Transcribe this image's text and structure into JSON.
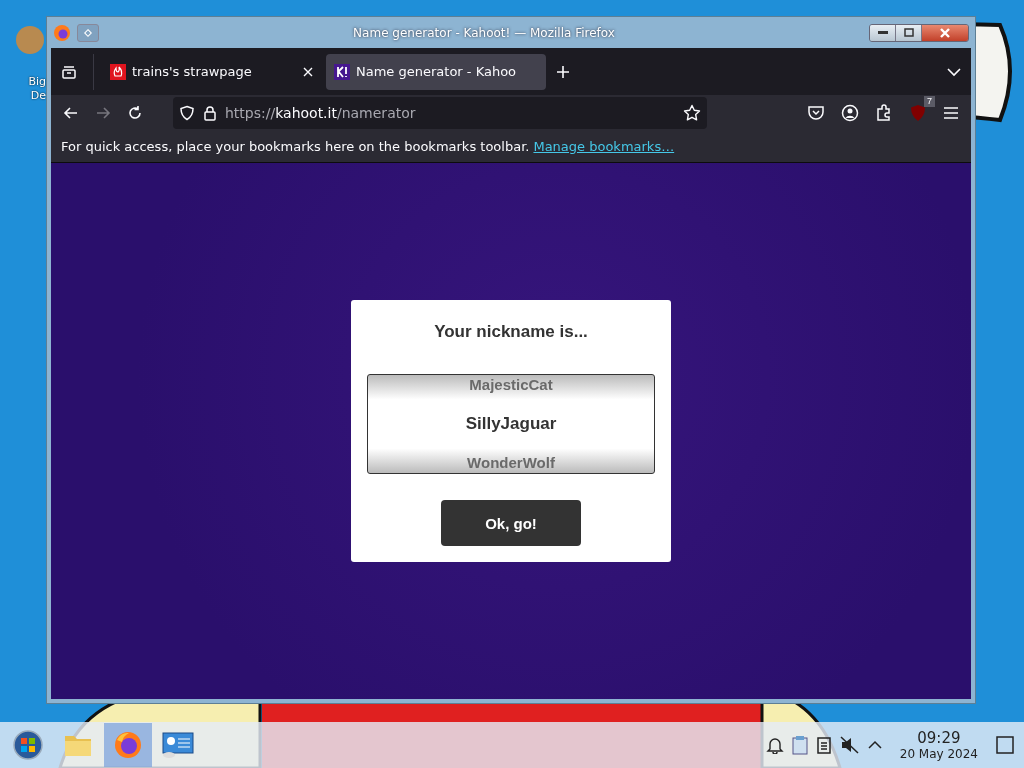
{
  "desktop": {
    "icon_label": [
      "Big",
      "De"
    ]
  },
  "window": {
    "title": "Name generator - Kahoot! — Mozilla Firefox"
  },
  "tabs": [
    {
      "title": "trains's strawpage",
      "selected": false
    },
    {
      "title": "Name generator - Kahoo",
      "selected": true
    }
  ],
  "address_bar": {
    "scheme": "https://",
    "host": "kahoot.it",
    "path": "/namerator"
  },
  "extension_badge": "7",
  "bookmarks_bar": {
    "message": "For quick access, place your bookmarks here on the bookmarks toolbar.",
    "link": "Manage bookmarks…"
  },
  "dialog": {
    "title": "Your nickname is...",
    "names": [
      {
        "name": "MajesticCat",
        "selected": false
      },
      {
        "name": "SillyJaguar",
        "selected": true
      },
      {
        "name": "WonderWolf",
        "selected": false
      }
    ],
    "button": "Ok, go!"
  },
  "taskbar": {
    "apps": [
      {
        "kind": "files",
        "active": false
      },
      {
        "kind": "browser",
        "active": true
      },
      {
        "kind": "settings",
        "active": false
      }
    ],
    "time": "09:29",
    "date": "20 May 2024"
  }
}
